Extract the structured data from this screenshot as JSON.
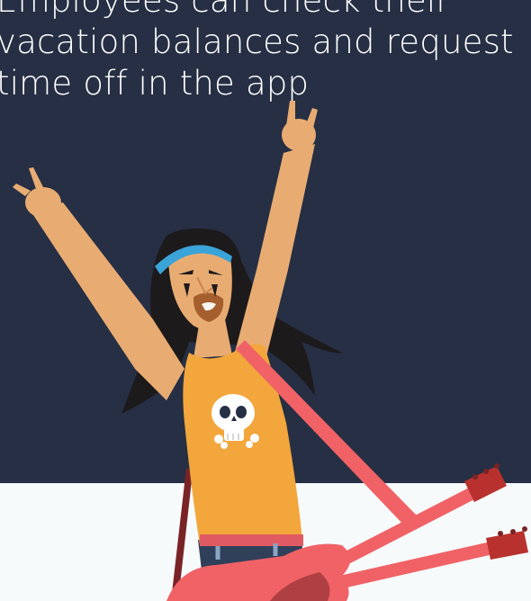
{
  "headline": {
    "lines": [
      "Employees can check their",
      "vacation balances and request",
      "time off in the app"
    ]
  },
  "illustration": {
    "subject": "rocker-with-double-neck-guitar",
    "colors": {
      "background": "#262f44",
      "floor": "#f6fafb",
      "skin": "#e8ac72",
      "hair": "#1d1a1c",
      "headband": "#3aa3d8",
      "shirt": "#f2a63b",
      "guitar": "#f06266",
      "guitar_head": "#b8312e",
      "belt": "#e05a64",
      "jeans": "#31405a"
    }
  }
}
